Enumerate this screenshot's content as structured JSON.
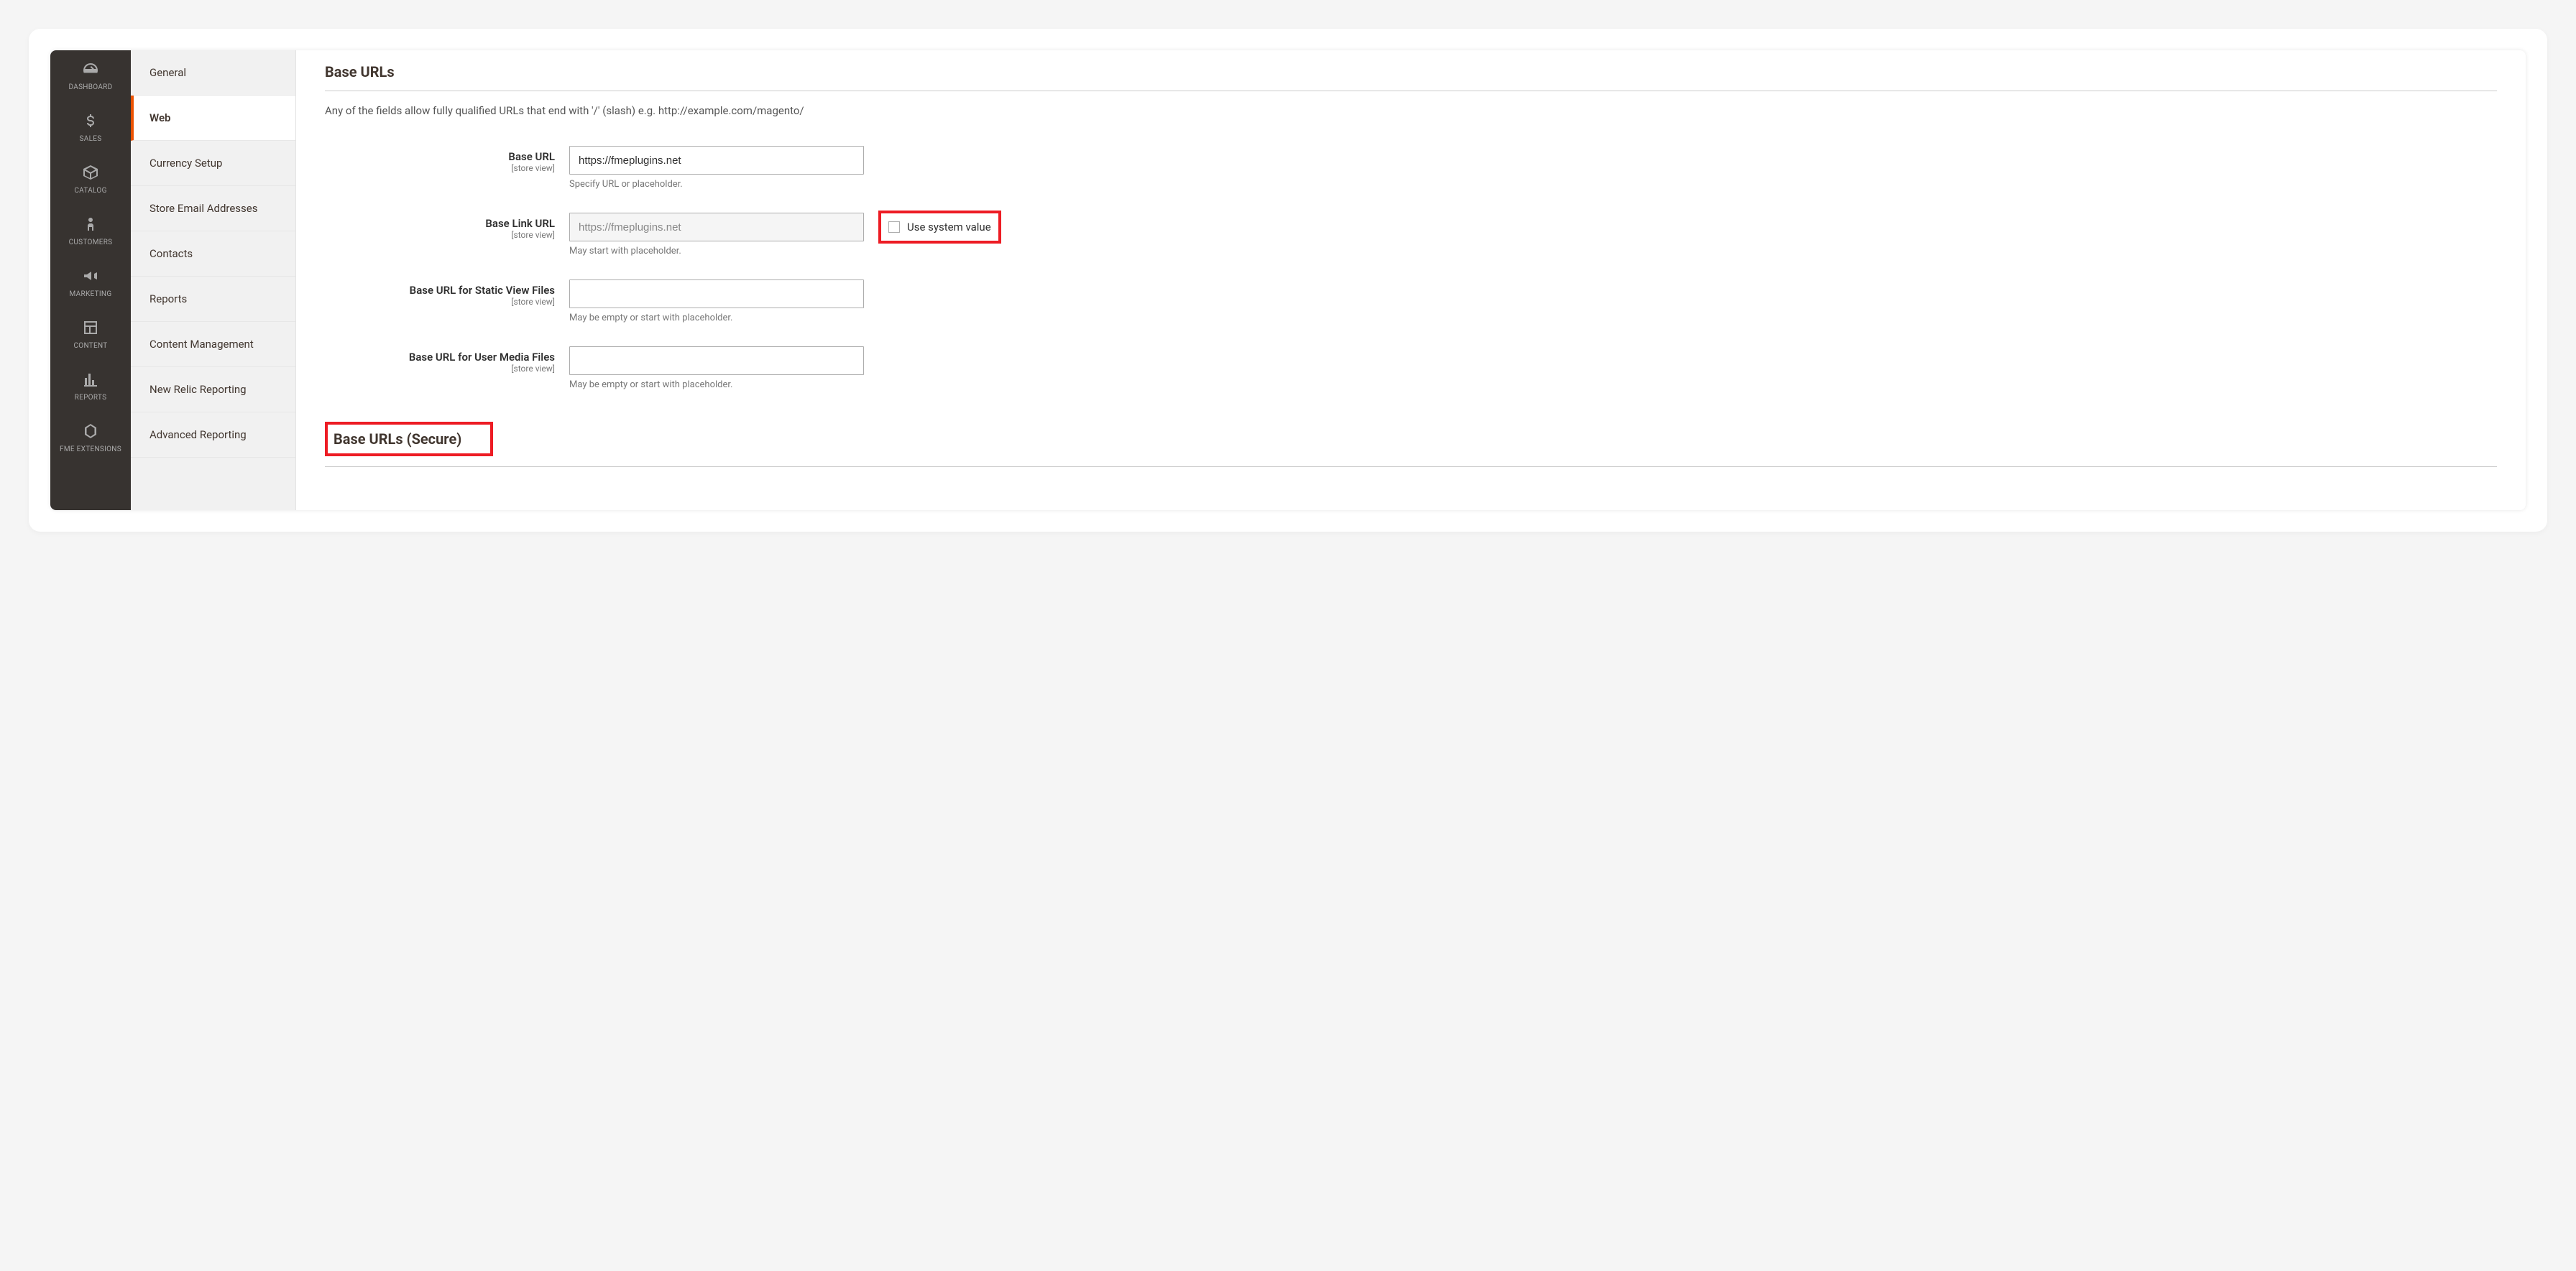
{
  "main_nav": {
    "items": [
      {
        "label": "DASHBOARD",
        "icon": "gauge"
      },
      {
        "label": "SALES",
        "icon": "dollar"
      },
      {
        "label": "CATALOG",
        "icon": "box"
      },
      {
        "label": "CUSTOMERS",
        "icon": "person"
      },
      {
        "label": "MARKETING",
        "icon": "megaphone"
      },
      {
        "label": "CONTENT",
        "icon": "layout"
      },
      {
        "label": "REPORTS",
        "icon": "bars"
      },
      {
        "label": "FME EXTENSIONS",
        "icon": "hex"
      }
    ]
  },
  "sub_nav": {
    "items": [
      {
        "label": "General"
      },
      {
        "label": "Web"
      },
      {
        "label": "Currency Setup"
      },
      {
        "label": "Store Email Addresses"
      },
      {
        "label": "Contacts"
      },
      {
        "label": "Reports"
      },
      {
        "label": "Content Management"
      },
      {
        "label": "New Relic Reporting"
      },
      {
        "label": "Advanced Reporting"
      }
    ],
    "active_index": 1
  },
  "section": {
    "title": "Base URLs",
    "description": "Any of the fields allow fully qualified URLs that end with '/' (slash) e.g. http://example.com/magento/",
    "scope_label": "[store view]",
    "use_system_value_label": "Use system value",
    "fields": [
      {
        "label": "Base URL",
        "value": "https://fmeplugins.net",
        "note": "Specify URL or placeholder.",
        "show_system_checkbox": false
      },
      {
        "label": "Base Link URL",
        "value": "https://fmeplugins.net",
        "note": "May start with placeholder.",
        "show_system_checkbox": true,
        "disabled": true,
        "highlight_checkbox": true
      },
      {
        "label": "Base URL for Static View Files",
        "value": "",
        "note": "May be empty or start with placeholder.",
        "show_system_checkbox": false
      },
      {
        "label": "Base URL for User Media Files",
        "value": "",
        "note": "May be empty or start with placeholder.",
        "show_system_checkbox": false
      }
    ],
    "secure_title": "Base URLs (Secure)"
  }
}
